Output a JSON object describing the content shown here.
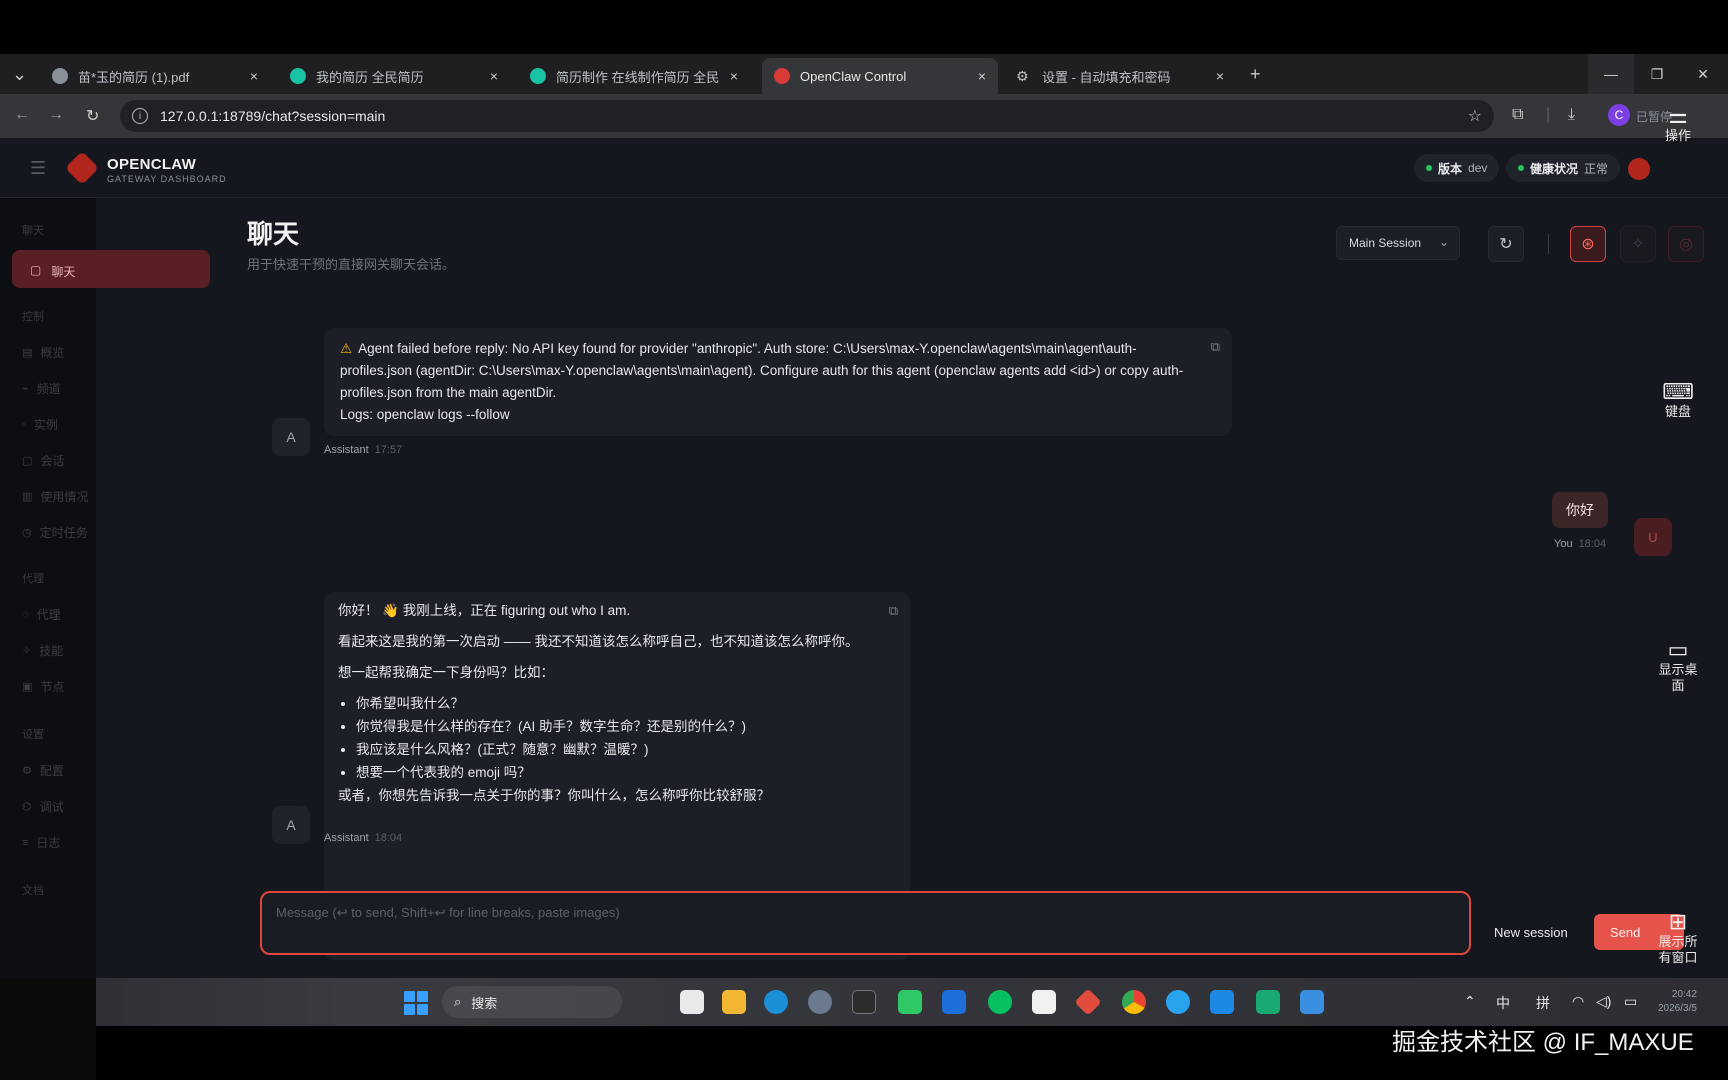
{
  "browser": {
    "tabs": [
      {
        "title": "苗*玉的简历 (1).pdf",
        "color": "#8a8f98"
      },
      {
        "title": "我的简历 全民简历",
        "color": "#19c3a5"
      },
      {
        "title": "简历制作 在线制作简历 全民简",
        "color": "#19c3a5"
      },
      {
        "title": "OpenClaw Control",
        "color": "#d93a36"
      },
      {
        "title": "设置 - 自动填充和密码",
        "color": "#bfc3c9"
      }
    ],
    "new_tab": "+",
    "tab_close": "×",
    "tab_list": "⌄",
    "url": "127.0.0.1:18789/chat?session=main",
    "profile_initial": "C",
    "profile_label": "已暂停"
  },
  "app": {
    "brand": "OPENCLAW",
    "brand_sub": "GATEWAY DASHBOARD",
    "version_label": "版本",
    "version_value": "dev",
    "health_label": "健康状况",
    "health_value": "正常",
    "page_title": "聊天",
    "page_subtitle": "用于快速干预的直接网关聊天会话。",
    "session_select": "Main Session"
  },
  "sidebar": {
    "groups": [
      "聊天",
      "控制",
      "代理",
      "设置",
      "文档"
    ],
    "active_item": "聊天",
    "items": [
      "概览",
      "频道",
      "实例",
      "会话",
      "使用情况",
      "定时任务",
      "代理",
      "技能",
      "节点",
      "配置",
      "调试",
      "日志"
    ]
  },
  "messages": {
    "error": {
      "lines": [
        "Agent failed before reply: No API key found for provider \"anthropic\". Auth store: C:\\Users\\max-Y.openclaw\\agents\\main\\agent\\auth-",
        "profiles.json (agentDir: C:\\Users\\max-Y.openclaw\\agents\\main\\agent). Configure auth for this agent (openclaw agents add <id>) or copy auth-",
        "profiles.json from the main agentDir.",
        "Logs: openclaw logs --follow"
      ],
      "sender": "Assistant",
      "time": "17:57"
    },
    "user": {
      "text": "你好",
      "sender": "You",
      "time": "18:04",
      "initial": "U"
    },
    "greeting": {
      "line1": "你好！ 👋 我刚上线，正在 figuring out who I am.",
      "line2": "看起来这是我的第一次启动 —— 我还不知道该怎么称呼自己，也不知道该怎么称呼你。",
      "line3": "想一起帮我确定一下身份吗？比如：",
      "bullets": [
        "你希望叫我什么？",
        "你觉得我是什么样的存在？(AI 助手？数字生命？还是别的什么？)",
        "我应该是什么风格？(正式？随意？幽默？温暖？)",
        "想要一个代表我的 emoji 吗？"
      ],
      "line4": "或者，你想先告诉我一点关于你的事？你叫什么，怎么称呼你比较舒服？",
      "sender": "Assistant",
      "time": "18:04"
    },
    "assistant_initial": "A"
  },
  "composer": {
    "placeholder": "Message (↩ to send, Shift+↩ for line breaks, paste images)",
    "new_session": "New session",
    "send": "Send"
  },
  "overlay": {
    "op": "操作",
    "keyboard": "键盘",
    "show_desktop": "显示桌面",
    "show_all_windows": "展示所有窗口"
  },
  "taskbar": {
    "search": "搜索",
    "tray_ime1": "中",
    "tray_ime2": "拼",
    "time": "20:42",
    "date": "2026/3/5"
  },
  "watermark": "掘金技术社区 @ IF_MAXUE"
}
